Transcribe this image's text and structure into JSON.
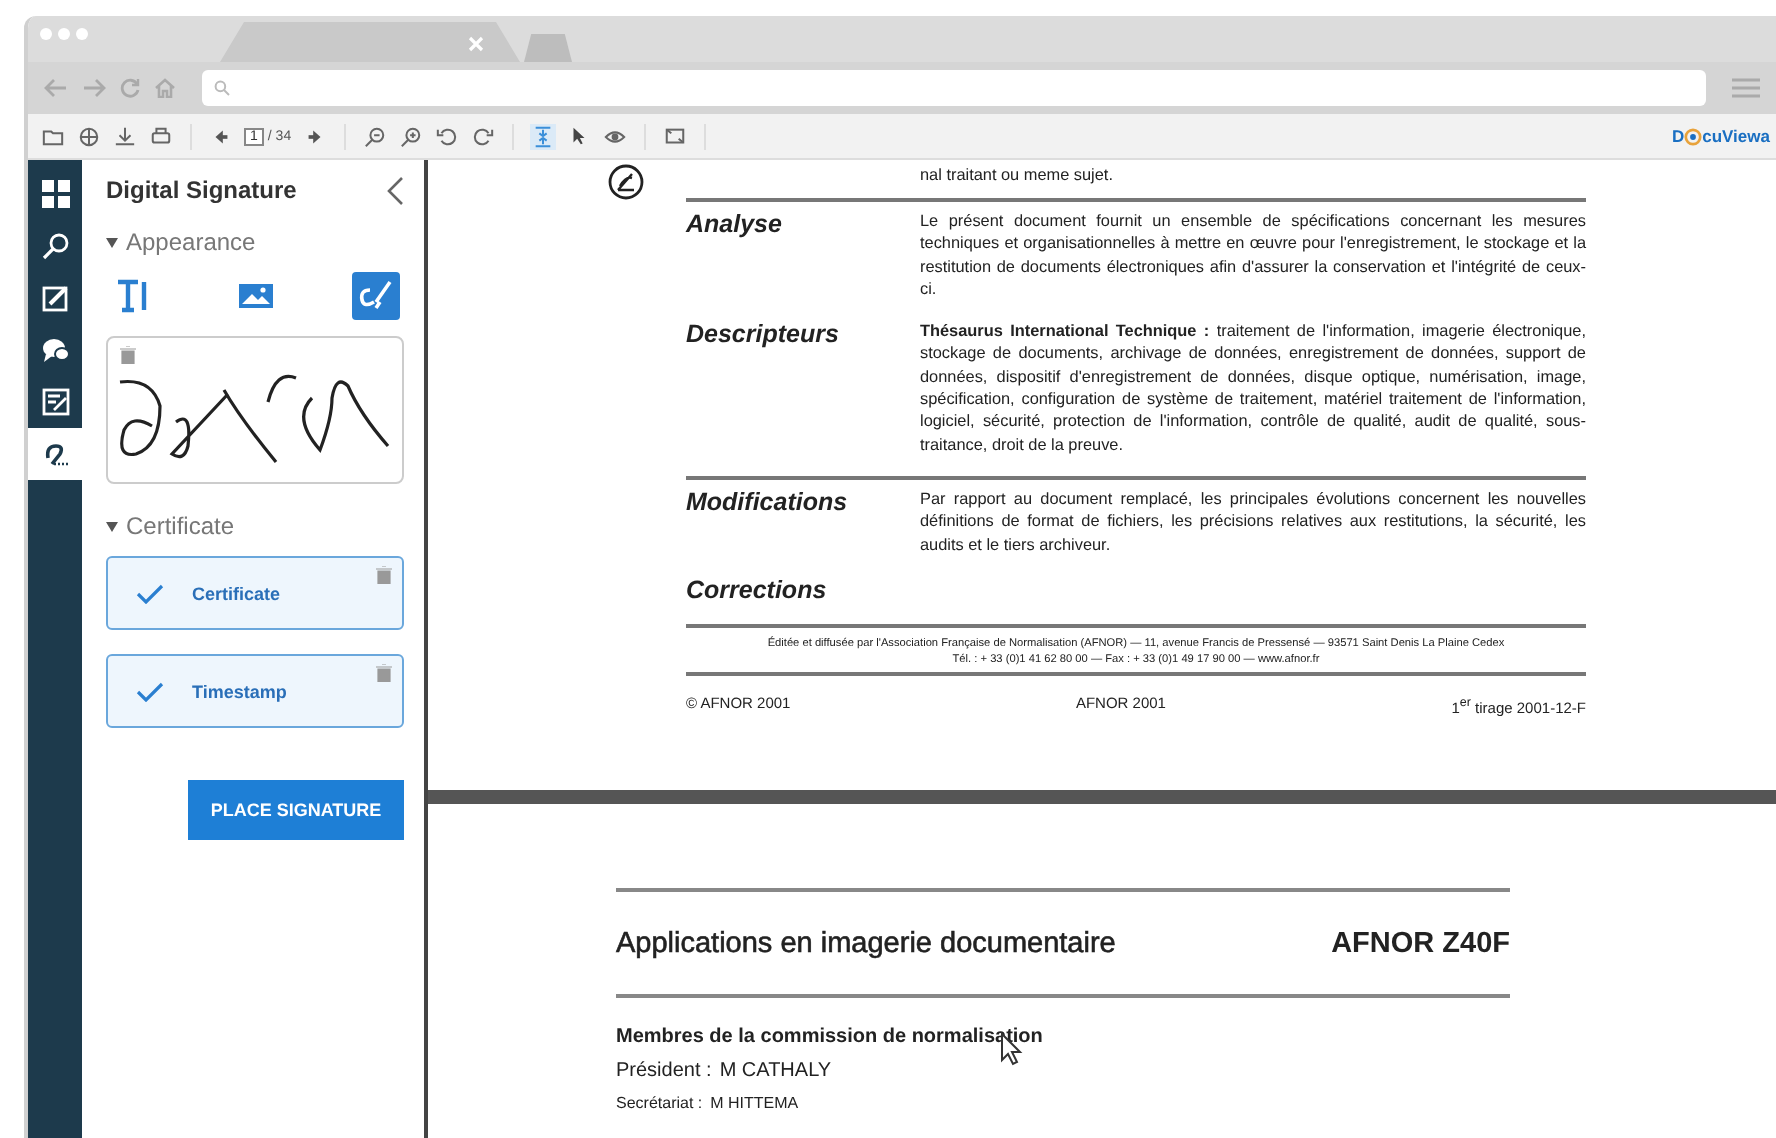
{
  "browser": {
    "tabs": [
      {
        "kind": "page"
      },
      {
        "kind": "new"
      }
    ]
  },
  "toolbar": {
    "groups": [
      [
        {
          "kind": "folder"
        },
        {
          "kind": "globe"
        },
        {
          "kind": "download"
        },
        {
          "kind": "print"
        }
      ],
      [
        {
          "kind": "prev"
        },
        {
          "kind": "page"
        },
        {
          "kind": "next"
        }
      ],
      [
        {
          "kind": "zoom-out"
        },
        {
          "kind": "zoom-in"
        },
        {
          "kind": "rotate-left"
        },
        {
          "kind": "rotate-right"
        }
      ],
      [
        {
          "kind": "fit",
          "selected": true
        },
        {
          "kind": "pointer",
          "selected": false
        },
        {
          "kind": "eye",
          "selected": false
        }
      ],
      [
        {
          "kind": "screen"
        }
      ]
    ],
    "page": "1",
    "page_total": "/ 34",
    "logo": {
      "before": "D",
      "after": "cuViewa"
    }
  },
  "rail": [
    {
      "kind": "thumbnails",
      "selected": false
    },
    {
      "kind": "search",
      "selected": false
    },
    {
      "kind": "annotate",
      "selected": false
    },
    {
      "kind": "comments",
      "selected": false
    },
    {
      "kind": "form",
      "selected": false
    },
    {
      "kind": "signature",
      "selected": true
    }
  ],
  "panel": {
    "title": "Digital Signature",
    "sections": [
      {
        "title": "Appearance",
        "expanded": true
      },
      {
        "title": "Certificate",
        "expanded": true
      }
    ],
    "modes": [
      {
        "kind": "text",
        "selected": false
      },
      {
        "kind": "image",
        "selected": false
      },
      {
        "kind": "draw",
        "selected": true
      }
    ],
    "certificates": [
      {
        "label": "Certificate",
        "checked": true
      },
      {
        "label": "Timestamp",
        "checked": true
      }
    ],
    "button": "PLACE SIGNATURE"
  },
  "page1": {
    "top_line": "nal traitant ou meme sujet.",
    "sections": [
      {
        "label": "Analyse",
        "rule_above": true,
        "text": "Le présent document fournit un ensemble de spécifications concernant les mesures techniques et organisationnelles à mettre en œuvre pour l'enregistrement, le stockage et la restitution de documents électroniques afin d'assurer la conservation et l'intégrité de ceux-ci."
      },
      {
        "label": "Descripteurs",
        "rule_above": false,
        "text": "**Thésaurus International Technique :** traitement de l'information, imagerie électronique, stockage de documents, archivage de données, enregistrement de données, support de données, dispositif d'enregistrement de données, disque optique, numérisation, image, spécification, configuration de système de traitement, matériel traitement de l'information, logiciel, sécurité, protection de l'information, contrôle de qualité, audit de qualité, sous-traitance, droit de la preuve."
      },
      {
        "label": "Modifications",
        "rule_above": true,
        "text": "Par rapport au document remplacé, les principales évolutions concernent les nouvelles définitions de format de fichiers, les précisions relatives aux restitutions, la sécurité, les audits et le tiers archiveur."
      },
      {
        "label": "Corrections",
        "rule_above": false
      }
    ],
    "publisher": [
      "Éditée et diffusée par l'Association Française de Normalisation (AFNOR) — 11, avenue Francis de Pressensé — 93571 Saint Denis La Plaine Cedex",
      "Tél. : + 33 (0)1 41 62 80 00 — Fax : + 33 (0)1 49 17 90 00 — www.afnor.fr"
    ],
    "footer": [
      "© AFNOR 2001",
      "AFNOR 2001",
      "1$^{er}$ tirage 2001-12-F"
    ]
  },
  "page2": {
    "title": "Applications en imagerie documentaire",
    "code": "AFNOR Z40F",
    "heading": "Membres de la commission de normalisation",
    "members": [
      {
        "role": "Président :",
        "name": "M CATHALY",
        "kind": "large"
      },
      {
        "role": "Secrétariat :",
        "name": "M HITTEMA",
        "kind": "small"
      }
    ]
  }
}
